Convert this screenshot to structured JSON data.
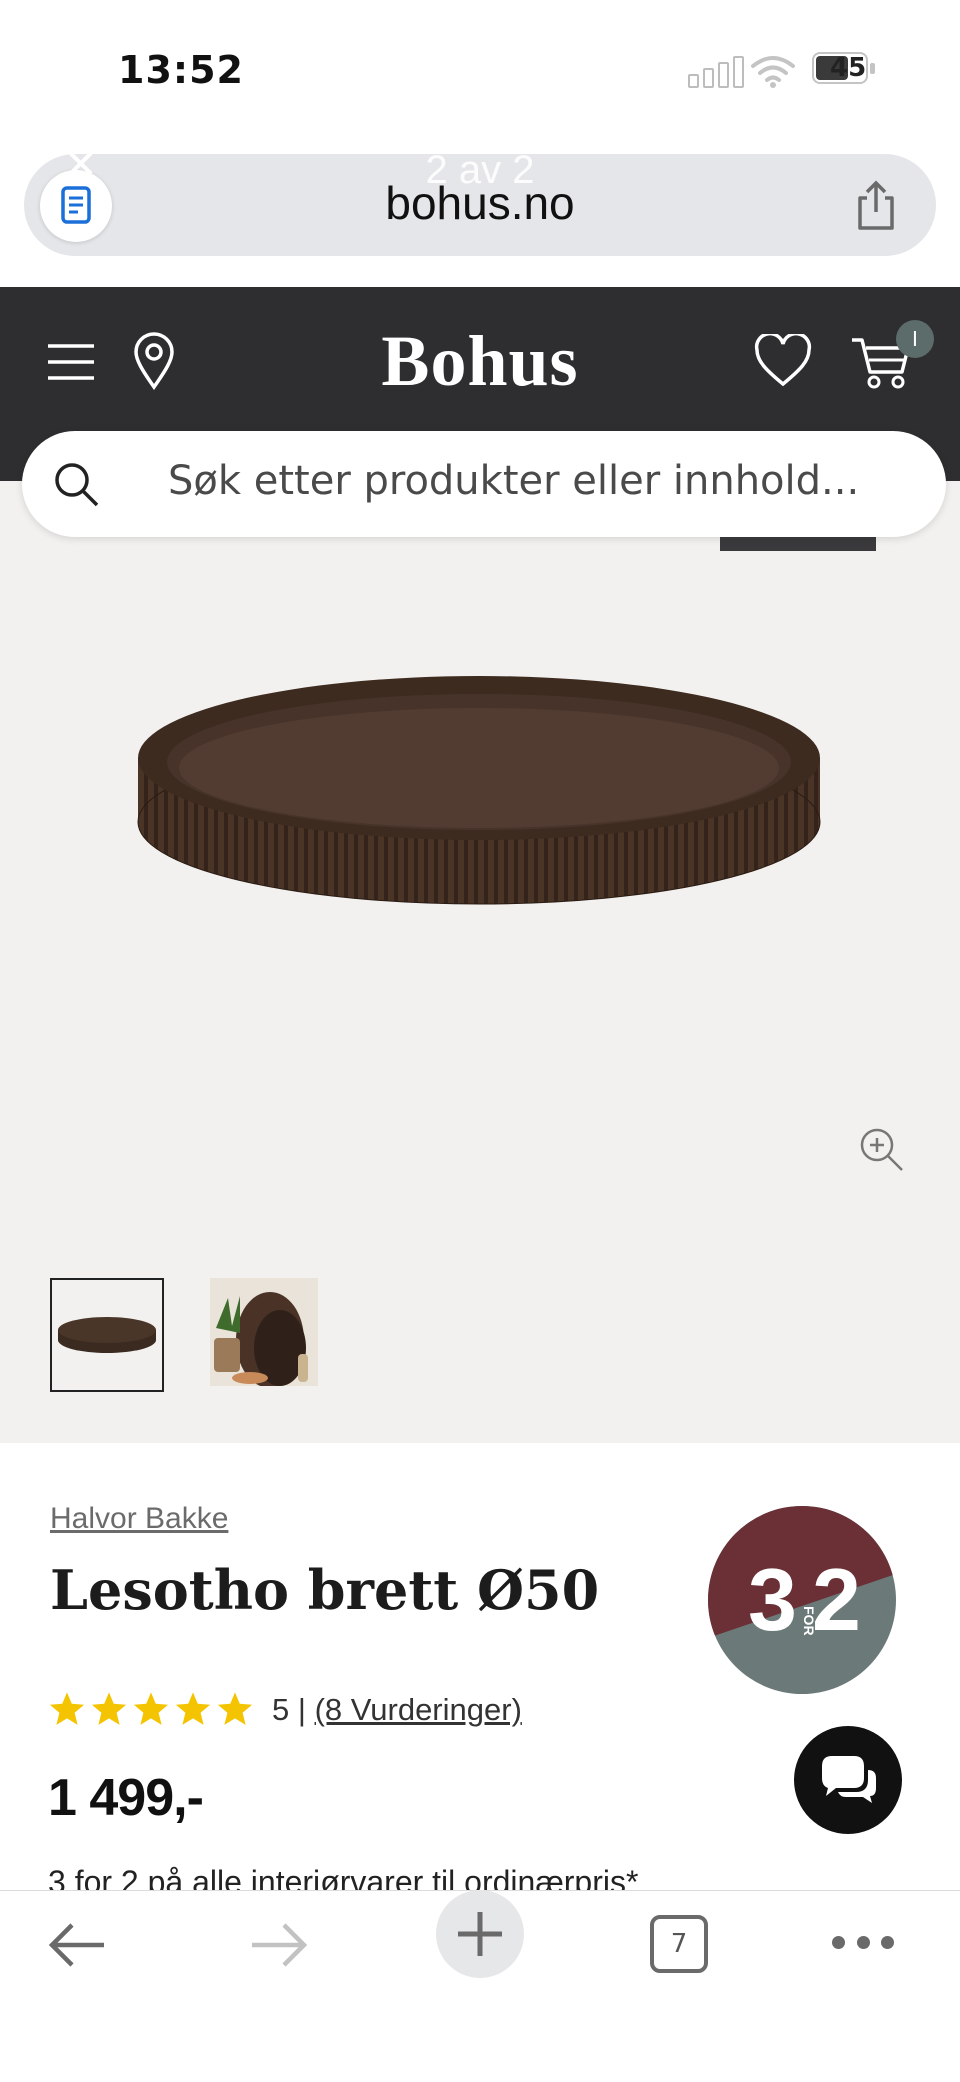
{
  "status_bar": {
    "time": "13:52",
    "battery": "45"
  },
  "browser": {
    "url": "bohus.no",
    "tab_overlay": "2 av 2",
    "open_tabs": "7"
  },
  "site": {
    "logo": "Bohus",
    "cart_count": "I",
    "search_placeholder": "Søk etter produkter eller innhold..."
  },
  "product": {
    "brand": "Halvor Bakke",
    "title": "Lesotho brett Ø50",
    "rating_value": "5",
    "rating_separator": "|",
    "reviews_link": "(8 Vurderinger)",
    "price": "1 499,-",
    "promo_text": "3 for 2 på alle interiørvarer til ordinærpris*",
    "badge": {
      "big_left": "3",
      "small": "FOR",
      "big_right": "2"
    },
    "stars": 5
  },
  "colors": {
    "header_bg": "#2e2e30",
    "image_bg": "#f3f1ef",
    "badge_top": "#6a3036",
    "badge_bottom": "#6b7a78",
    "star": "#f5c400"
  },
  "icons": [
    "reader-icon",
    "share-icon",
    "menu-icon",
    "location-icon",
    "heart-icon",
    "cart-icon",
    "search-icon",
    "zoom-icon",
    "chat-icon",
    "back-icon",
    "forward-icon",
    "plus-icon",
    "tabs-icon",
    "more-icon"
  ]
}
